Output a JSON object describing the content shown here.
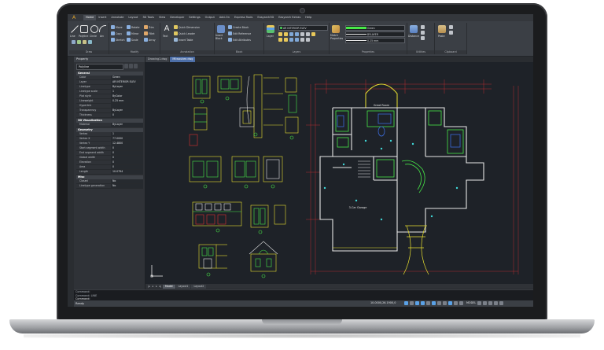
{
  "menu": {
    "logo": "A",
    "items": [
      "Home",
      "Insert",
      "Annotate",
      "Layout",
      "3D Tools",
      "View",
      "Developer",
      "Settings",
      "Output",
      "Add-On",
      "Express Tools",
      "Easyarch3D",
      "Easyarch Extras",
      "Help"
    ],
    "active_index": 0
  },
  "ribbon": {
    "draw": {
      "label": "Draw",
      "line": "Line",
      "polyline": "Polyline",
      "circle": "Circle",
      "arc": "Arc"
    },
    "modify": {
      "label": "Modify",
      "move": "Move",
      "rotate": "Rotate",
      "trim": "Trim",
      "copy": "Copy",
      "mirror": "Mirror",
      "fillet": "Fillet",
      "stretch": "Stretch",
      "scale": "Scale",
      "array": "Array"
    },
    "annotation": {
      "label": "Annotation",
      "text": "Text",
      "quick_dimension": "Quick Dimension",
      "quick_leader": "Quick Leader",
      "insert_table": "Insert Table"
    },
    "block": {
      "label": "Block",
      "insert_block": "Insert Block",
      "create_block": "Create Block",
      "edit_reference": "Edit Reference",
      "edit_attributes": "Edit Attributes"
    },
    "layers": {
      "label": "Layers",
      "layer_button": "Layer",
      "current_layer": "AR INTERIOR ELEV"
    },
    "properties": {
      "label": "Properties",
      "match": "Match Properties",
      "color": "Green",
      "linetype": "BYLAYER",
      "lineweight": "0.25 mm"
    },
    "utilities": {
      "label": "Utilities",
      "distance": "Distance"
    },
    "clipboard": {
      "label": "Clipboard",
      "paste": "Paste"
    }
  },
  "doc_tabs": [
    "Drawing1.dwg",
    "Milwaukee.dwg"
  ],
  "active_doc_tab": 1,
  "properties_panel": {
    "title": "Property",
    "selection": "Polyline",
    "sections": [
      {
        "name": "General",
        "rows": [
          [
            "Color",
            "Green"
          ],
          [
            "Layer",
            "AR INTERIOR ELEV"
          ],
          [
            "Linetype",
            "ByLayer"
          ],
          [
            "Linetype scale",
            "1"
          ],
          [
            "Plot style",
            "ByColor"
          ],
          [
            "Lineweight",
            "0.25 mm"
          ],
          [
            "Hyperlink",
            ""
          ],
          [
            "Transparency",
            "ByLayer"
          ],
          [
            "Thickness",
            "0"
          ]
        ]
      },
      {
        "name": "3D Visualization",
        "rows": [
          [
            "Material",
            "ByLayer"
          ]
        ]
      },
      {
        "name": "Geometry",
        "rows": [
          [
            "Vertex",
            "1"
          ],
          [
            "Vertex X",
            "77.0000"
          ],
          [
            "Vertex Y",
            "12.4800"
          ],
          [
            "Start segment width",
            "0"
          ],
          [
            "End segment width",
            "0"
          ],
          [
            "Global width",
            "0"
          ],
          [
            "Elevation",
            "0"
          ],
          [
            "Area",
            "0"
          ],
          [
            "Length",
            "10.0794"
          ]
        ]
      },
      {
        "name": "Misc",
        "rows": [
          [
            "Closed",
            "No"
          ],
          [
            "Linetype generation",
            "No"
          ]
        ]
      }
    ]
  },
  "canvas": {
    "room_labels": [
      "Great Room",
      "3-Car Garage"
    ]
  },
  "layout_tabs": [
    "Model",
    "Layout1",
    "Layout2"
  ],
  "active_layout": 0,
  "command": {
    "history1": "Command:",
    "history2": "Command: LINE",
    "prompt": "Command:"
  },
  "status": {
    "text": "Ready",
    "coords": "10.0000,26.1900,0",
    "model": "MODEL"
  },
  "colors": {
    "drawing_yellow": "#e8e030",
    "drawing_green": "#48e848",
    "drawing_red": "#d83030",
    "drawing_white": "#e6e6e6",
    "drawing_blue": "#3a6ad8",
    "drawing_cyan": "#40d8d8"
  }
}
